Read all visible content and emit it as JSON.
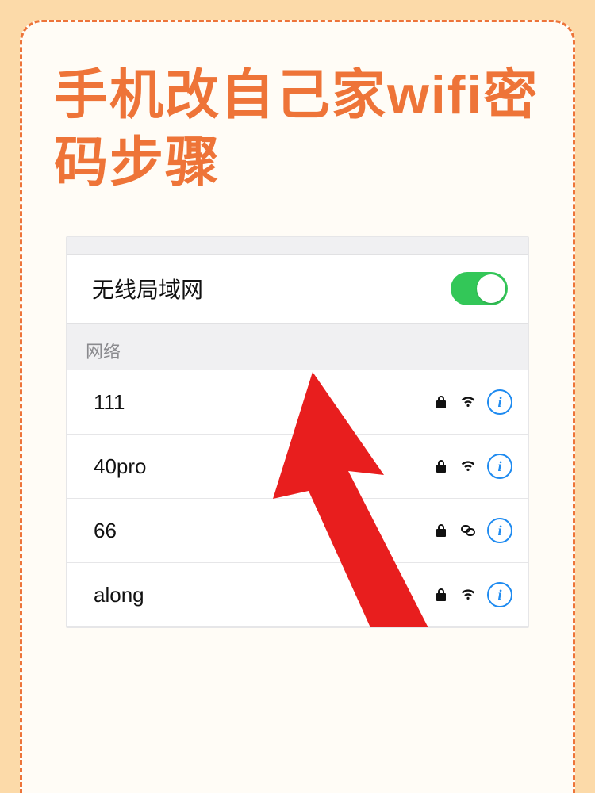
{
  "title": "手机改自己家wifi密码步骤",
  "wlan": {
    "label": "无线局域网",
    "enabled": true
  },
  "section_label": "网络",
  "networks": [
    {
      "name": "111",
      "locked": true,
      "signal": "wifi"
    },
    {
      "name": "40pro",
      "locked": true,
      "signal": "wifi"
    },
    {
      "name": "66",
      "locked": true,
      "signal": "link"
    },
    {
      "name": "along",
      "locked": true,
      "signal": "wifi"
    }
  ]
}
